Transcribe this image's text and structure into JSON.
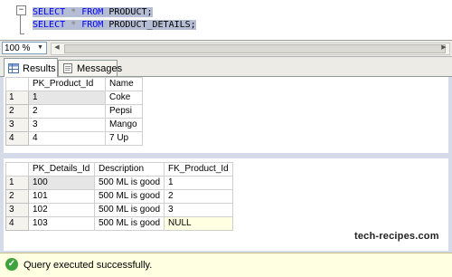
{
  "editor": {
    "line1": {
      "kw1": "SELECT",
      "star": "*",
      "kw2": "FROM",
      "table": "PRODUCT;"
    },
    "line2": {
      "kw1": "SELECT",
      "star": "*",
      "kw2": "FROM",
      "table": "PRODUCT_DETAILS;"
    },
    "outline_symbol": "−"
  },
  "zoom": {
    "value": "100 %"
  },
  "tabs": [
    {
      "label": "Results",
      "icon": "grid-icon",
      "active": true
    },
    {
      "label": "Messages",
      "icon": "messages-icon",
      "active": false
    }
  ],
  "grid1": {
    "columns": [
      "PK_Product_Id",
      "Name"
    ],
    "rows": [
      {
        "n": "1",
        "cells": [
          "1",
          "Coke"
        ]
      },
      {
        "n": "2",
        "cells": [
          "2",
          "Pepsi"
        ]
      },
      {
        "n": "3",
        "cells": [
          "3",
          "Mango"
        ]
      },
      {
        "n": "4",
        "cells": [
          "4",
          "7 Up"
        ]
      }
    ]
  },
  "grid2": {
    "columns": [
      "PK_Details_Id",
      "Description",
      "FK_Product_Id"
    ],
    "rows": [
      {
        "n": "1",
        "cells": [
          "100",
          "500 ML is good",
          "1"
        ]
      },
      {
        "n": "2",
        "cells": [
          "101",
          "500 ML is good",
          "2"
        ]
      },
      {
        "n": "3",
        "cells": [
          "102",
          "500 ML is good",
          "3"
        ]
      },
      {
        "n": "4",
        "cells": [
          "103",
          "500 ML is good",
          "NULL"
        ]
      }
    ]
  },
  "watermark": "tech-recipes.com",
  "status": {
    "message": "Query executed successfully.",
    "icon": "check-icon",
    "color": "#3fa23f"
  }
}
